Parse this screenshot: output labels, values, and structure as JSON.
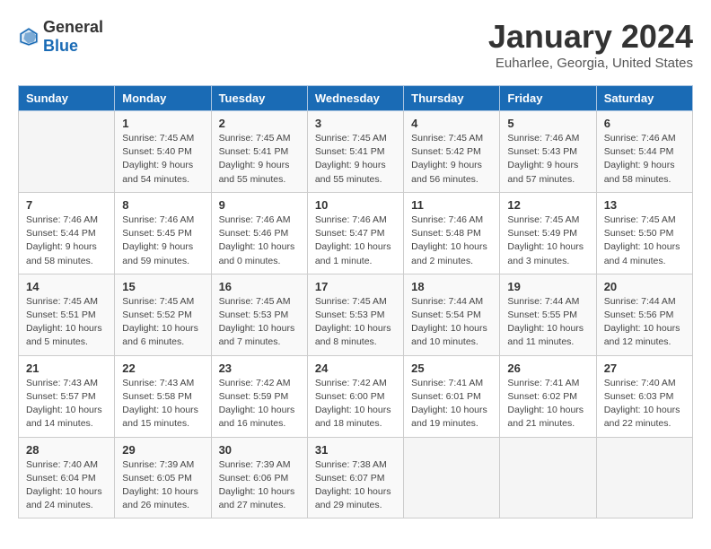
{
  "header": {
    "logo_general": "General",
    "logo_blue": "Blue",
    "title": "January 2024",
    "subtitle": "Euharlee, Georgia, United States"
  },
  "calendar": {
    "days_of_week": [
      "Sunday",
      "Monday",
      "Tuesday",
      "Wednesday",
      "Thursday",
      "Friday",
      "Saturday"
    ],
    "weeks": [
      [
        {
          "day": "",
          "info": ""
        },
        {
          "day": "1",
          "info": "Sunrise: 7:45 AM\nSunset: 5:40 PM\nDaylight: 9 hours\nand 54 minutes."
        },
        {
          "day": "2",
          "info": "Sunrise: 7:45 AM\nSunset: 5:41 PM\nDaylight: 9 hours\nand 55 minutes."
        },
        {
          "day": "3",
          "info": "Sunrise: 7:45 AM\nSunset: 5:41 PM\nDaylight: 9 hours\nand 55 minutes."
        },
        {
          "day": "4",
          "info": "Sunrise: 7:45 AM\nSunset: 5:42 PM\nDaylight: 9 hours\nand 56 minutes."
        },
        {
          "day": "5",
          "info": "Sunrise: 7:46 AM\nSunset: 5:43 PM\nDaylight: 9 hours\nand 57 minutes."
        },
        {
          "day": "6",
          "info": "Sunrise: 7:46 AM\nSunset: 5:44 PM\nDaylight: 9 hours\nand 58 minutes."
        }
      ],
      [
        {
          "day": "7",
          "info": "Sunrise: 7:46 AM\nSunset: 5:44 PM\nDaylight: 9 hours\nand 58 minutes."
        },
        {
          "day": "8",
          "info": "Sunrise: 7:46 AM\nSunset: 5:45 PM\nDaylight: 9 hours\nand 59 minutes."
        },
        {
          "day": "9",
          "info": "Sunrise: 7:46 AM\nSunset: 5:46 PM\nDaylight: 10 hours\nand 0 minutes."
        },
        {
          "day": "10",
          "info": "Sunrise: 7:46 AM\nSunset: 5:47 PM\nDaylight: 10 hours\nand 1 minute."
        },
        {
          "day": "11",
          "info": "Sunrise: 7:46 AM\nSunset: 5:48 PM\nDaylight: 10 hours\nand 2 minutes."
        },
        {
          "day": "12",
          "info": "Sunrise: 7:45 AM\nSunset: 5:49 PM\nDaylight: 10 hours\nand 3 minutes."
        },
        {
          "day": "13",
          "info": "Sunrise: 7:45 AM\nSunset: 5:50 PM\nDaylight: 10 hours\nand 4 minutes."
        }
      ],
      [
        {
          "day": "14",
          "info": "Sunrise: 7:45 AM\nSunset: 5:51 PM\nDaylight: 10 hours\nand 5 minutes."
        },
        {
          "day": "15",
          "info": "Sunrise: 7:45 AM\nSunset: 5:52 PM\nDaylight: 10 hours\nand 6 minutes."
        },
        {
          "day": "16",
          "info": "Sunrise: 7:45 AM\nSunset: 5:53 PM\nDaylight: 10 hours\nand 7 minutes."
        },
        {
          "day": "17",
          "info": "Sunrise: 7:45 AM\nSunset: 5:53 PM\nDaylight: 10 hours\nand 8 minutes."
        },
        {
          "day": "18",
          "info": "Sunrise: 7:44 AM\nSunset: 5:54 PM\nDaylight: 10 hours\nand 10 minutes."
        },
        {
          "day": "19",
          "info": "Sunrise: 7:44 AM\nSunset: 5:55 PM\nDaylight: 10 hours\nand 11 minutes."
        },
        {
          "day": "20",
          "info": "Sunrise: 7:44 AM\nSunset: 5:56 PM\nDaylight: 10 hours\nand 12 minutes."
        }
      ],
      [
        {
          "day": "21",
          "info": "Sunrise: 7:43 AM\nSunset: 5:57 PM\nDaylight: 10 hours\nand 14 minutes."
        },
        {
          "day": "22",
          "info": "Sunrise: 7:43 AM\nSunset: 5:58 PM\nDaylight: 10 hours\nand 15 minutes."
        },
        {
          "day": "23",
          "info": "Sunrise: 7:42 AM\nSunset: 5:59 PM\nDaylight: 10 hours\nand 16 minutes."
        },
        {
          "day": "24",
          "info": "Sunrise: 7:42 AM\nSunset: 6:00 PM\nDaylight: 10 hours\nand 18 minutes."
        },
        {
          "day": "25",
          "info": "Sunrise: 7:41 AM\nSunset: 6:01 PM\nDaylight: 10 hours\nand 19 minutes."
        },
        {
          "day": "26",
          "info": "Sunrise: 7:41 AM\nSunset: 6:02 PM\nDaylight: 10 hours\nand 21 minutes."
        },
        {
          "day": "27",
          "info": "Sunrise: 7:40 AM\nSunset: 6:03 PM\nDaylight: 10 hours\nand 22 minutes."
        }
      ],
      [
        {
          "day": "28",
          "info": "Sunrise: 7:40 AM\nSunset: 6:04 PM\nDaylight: 10 hours\nand 24 minutes."
        },
        {
          "day": "29",
          "info": "Sunrise: 7:39 AM\nSunset: 6:05 PM\nDaylight: 10 hours\nand 26 minutes."
        },
        {
          "day": "30",
          "info": "Sunrise: 7:39 AM\nSunset: 6:06 PM\nDaylight: 10 hours\nand 27 minutes."
        },
        {
          "day": "31",
          "info": "Sunrise: 7:38 AM\nSunset: 6:07 PM\nDaylight: 10 hours\nand 29 minutes."
        },
        {
          "day": "",
          "info": ""
        },
        {
          "day": "",
          "info": ""
        },
        {
          "day": "",
          "info": ""
        }
      ]
    ]
  }
}
